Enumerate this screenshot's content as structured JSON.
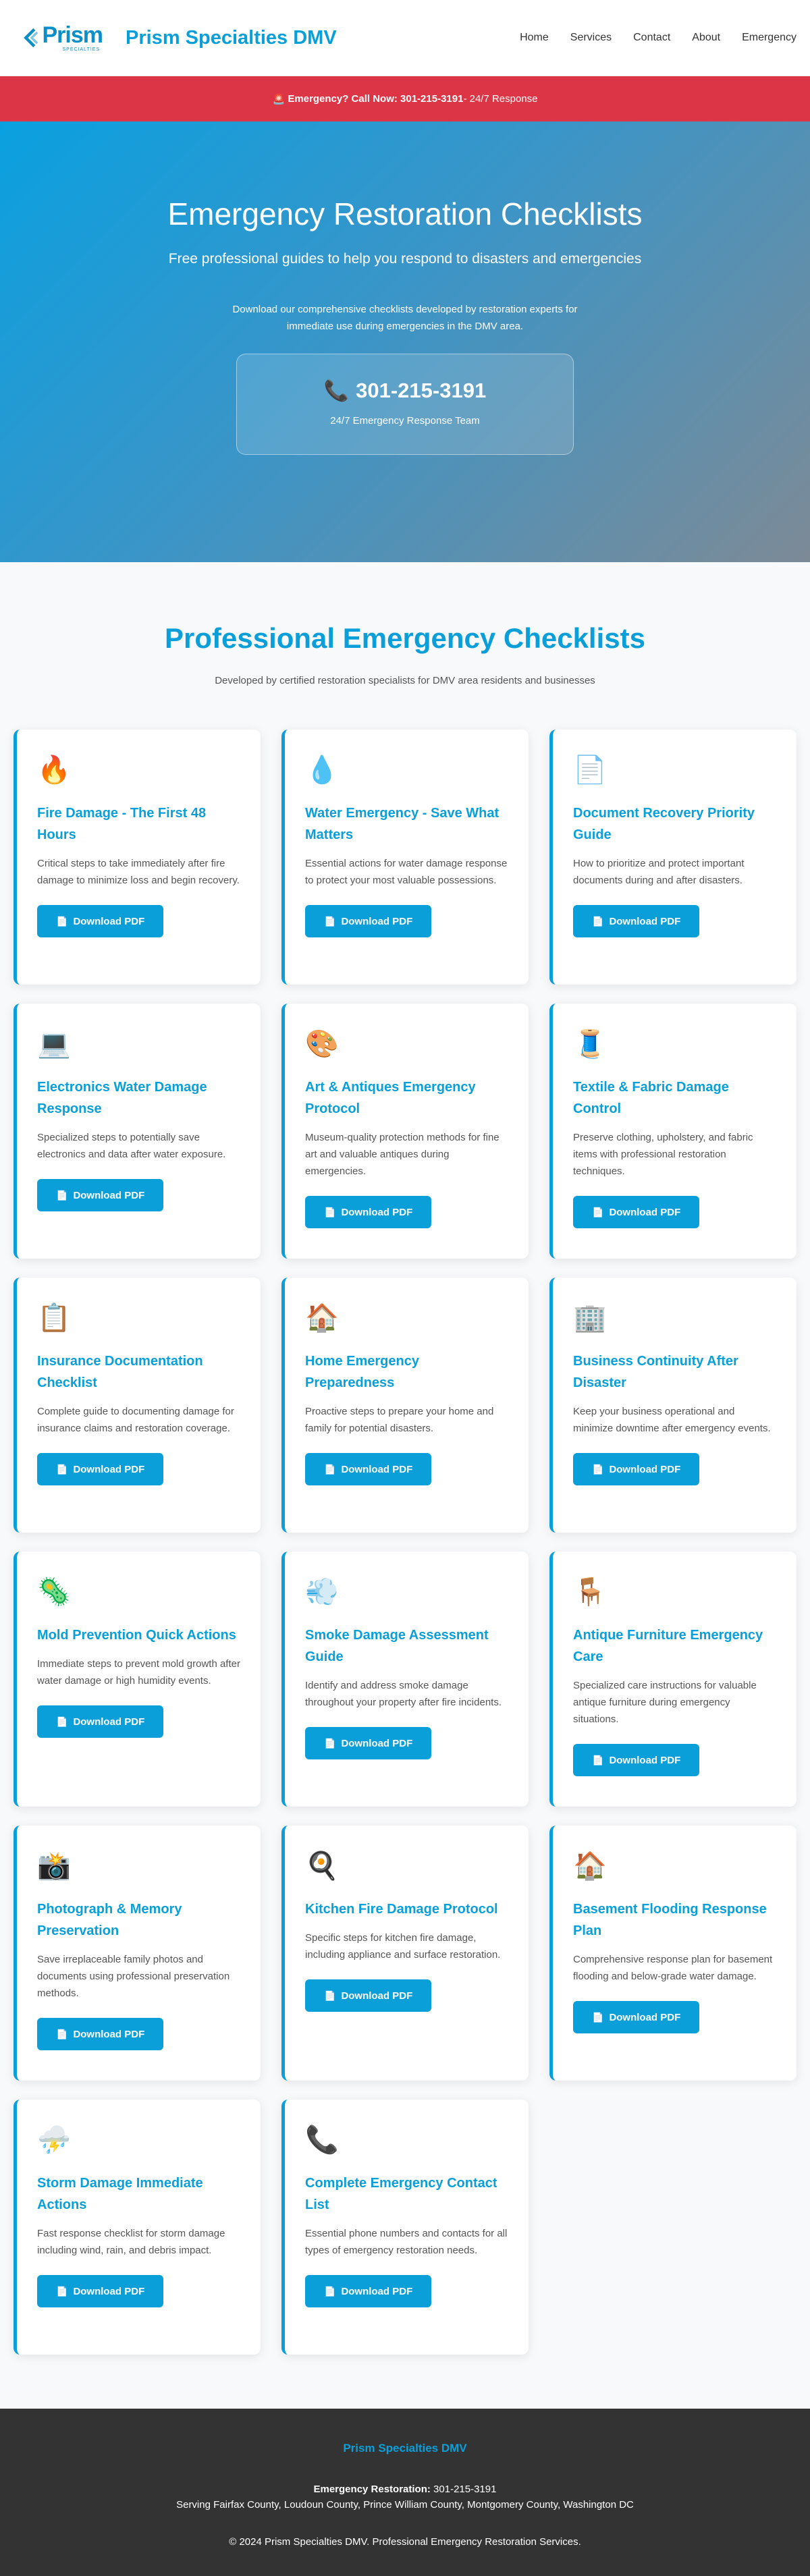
{
  "header": {
    "logo_word": "Prism",
    "logo_sub": "SPECIALTIES",
    "site_title": "Prism Specialties DMV",
    "nav": [
      "Home",
      "Services",
      "Contact",
      "About",
      "Emergency"
    ]
  },
  "banner": {
    "icon": "🚨",
    "bold": "Emergency? Call Now: 301-215-3191",
    "rest": " - 24/7 Response"
  },
  "hero": {
    "title": "Emergency Restoration Checklists",
    "subtitle": "Free professional guides to help you respond to disasters and emergencies",
    "desc": "Download our comprehensive checklists developed by restoration experts for immediate use during emergencies in the DMV area.",
    "phone_icon": "📞",
    "phone": "301-215-3191",
    "team": "24/7 Emergency Response Team"
  },
  "checklists": {
    "title": "Professional Emergency Checklists",
    "lead": "Developed by certified restoration specialists for DMV area residents and businesses",
    "button_label": "Download PDF",
    "button_icon": "📄",
    "cards": [
      {
        "icon": "🔥",
        "title": "Fire Damage - The First 48 Hours",
        "text": "Critical steps to take immediately after fire damage to minimize loss and begin recovery."
      },
      {
        "icon": "💧",
        "title": "Water Emergency - Save What Matters",
        "text": "Essential actions for water damage response to protect your most valuable possessions."
      },
      {
        "icon": "📄",
        "title": "Document Recovery Priority Guide",
        "text": "How to prioritize and protect important documents during and after disasters."
      },
      {
        "icon": "💻",
        "title": "Electronics Water Damage Response",
        "text": "Specialized steps to potentially save electronics and data after water exposure."
      },
      {
        "icon": "🎨",
        "title": "Art & Antiques Emergency Protocol",
        "text": "Museum-quality protection methods for fine art and valuable antiques during emergencies."
      },
      {
        "icon": "🧵",
        "title": "Textile & Fabric Damage Control",
        "text": "Preserve clothing, upholstery, and fabric items with professional restoration techniques."
      },
      {
        "icon": "📋",
        "title": "Insurance Documentation Checklist",
        "text": "Complete guide to documenting damage for insurance claims and restoration coverage."
      },
      {
        "icon": "🏠",
        "title": "Home Emergency Preparedness",
        "text": "Proactive steps to prepare your home and family for potential disasters."
      },
      {
        "icon": "🏢",
        "title": "Business Continuity After Disaster",
        "text": "Keep your business operational and minimize downtime after emergency events."
      },
      {
        "icon": "🦠",
        "title": "Mold Prevention Quick Actions",
        "text": "Immediate steps to prevent mold growth after water damage or high humidity events."
      },
      {
        "icon": "💨",
        "title": "Smoke Damage Assessment Guide",
        "text": "Identify and address smoke damage throughout your property after fire incidents."
      },
      {
        "icon": "🪑",
        "title": "Antique Furniture Emergency Care",
        "text": "Specialized care instructions for valuable antique furniture during emergency situations."
      },
      {
        "icon": "📸",
        "title": "Photograph & Memory Preservation",
        "text": "Save irreplaceable family photos and documents using professional preservation methods."
      },
      {
        "icon": "🍳",
        "title": "Kitchen Fire Damage Protocol",
        "text": "Specific steps for kitchen fire damage, including appliance and surface restoration."
      },
      {
        "icon": "🏠",
        "title": "Basement Flooding Response Plan",
        "text": "Comprehensive response plan for basement flooding and below-grade water damage."
      },
      {
        "icon": "⛈️",
        "title": "Storm Damage Immediate Actions",
        "text": "Fast response checklist for storm damage including wind, rain, and debris impact."
      },
      {
        "icon": "📞",
        "title": "Complete Emergency Contact List",
        "text": "Essential phone numbers and contacts for all types of emergency restoration needs."
      }
    ]
  },
  "footer": {
    "title": "Prism Specialties DMV",
    "emergency_label": "Emergency Restoration:",
    "emergency_phone": " 301-215-3191",
    "serving": "Serving Fairfax County, Loudoun County, Prince William County, Montgomery County, Washington DC",
    "copyright": "© 2024 Prism Specialties DMV. Professional Emergency Restoration Services."
  },
  "colors": {
    "brand": "#0a9fd8",
    "banner": "#dc3545",
    "footer": "#333333"
  }
}
